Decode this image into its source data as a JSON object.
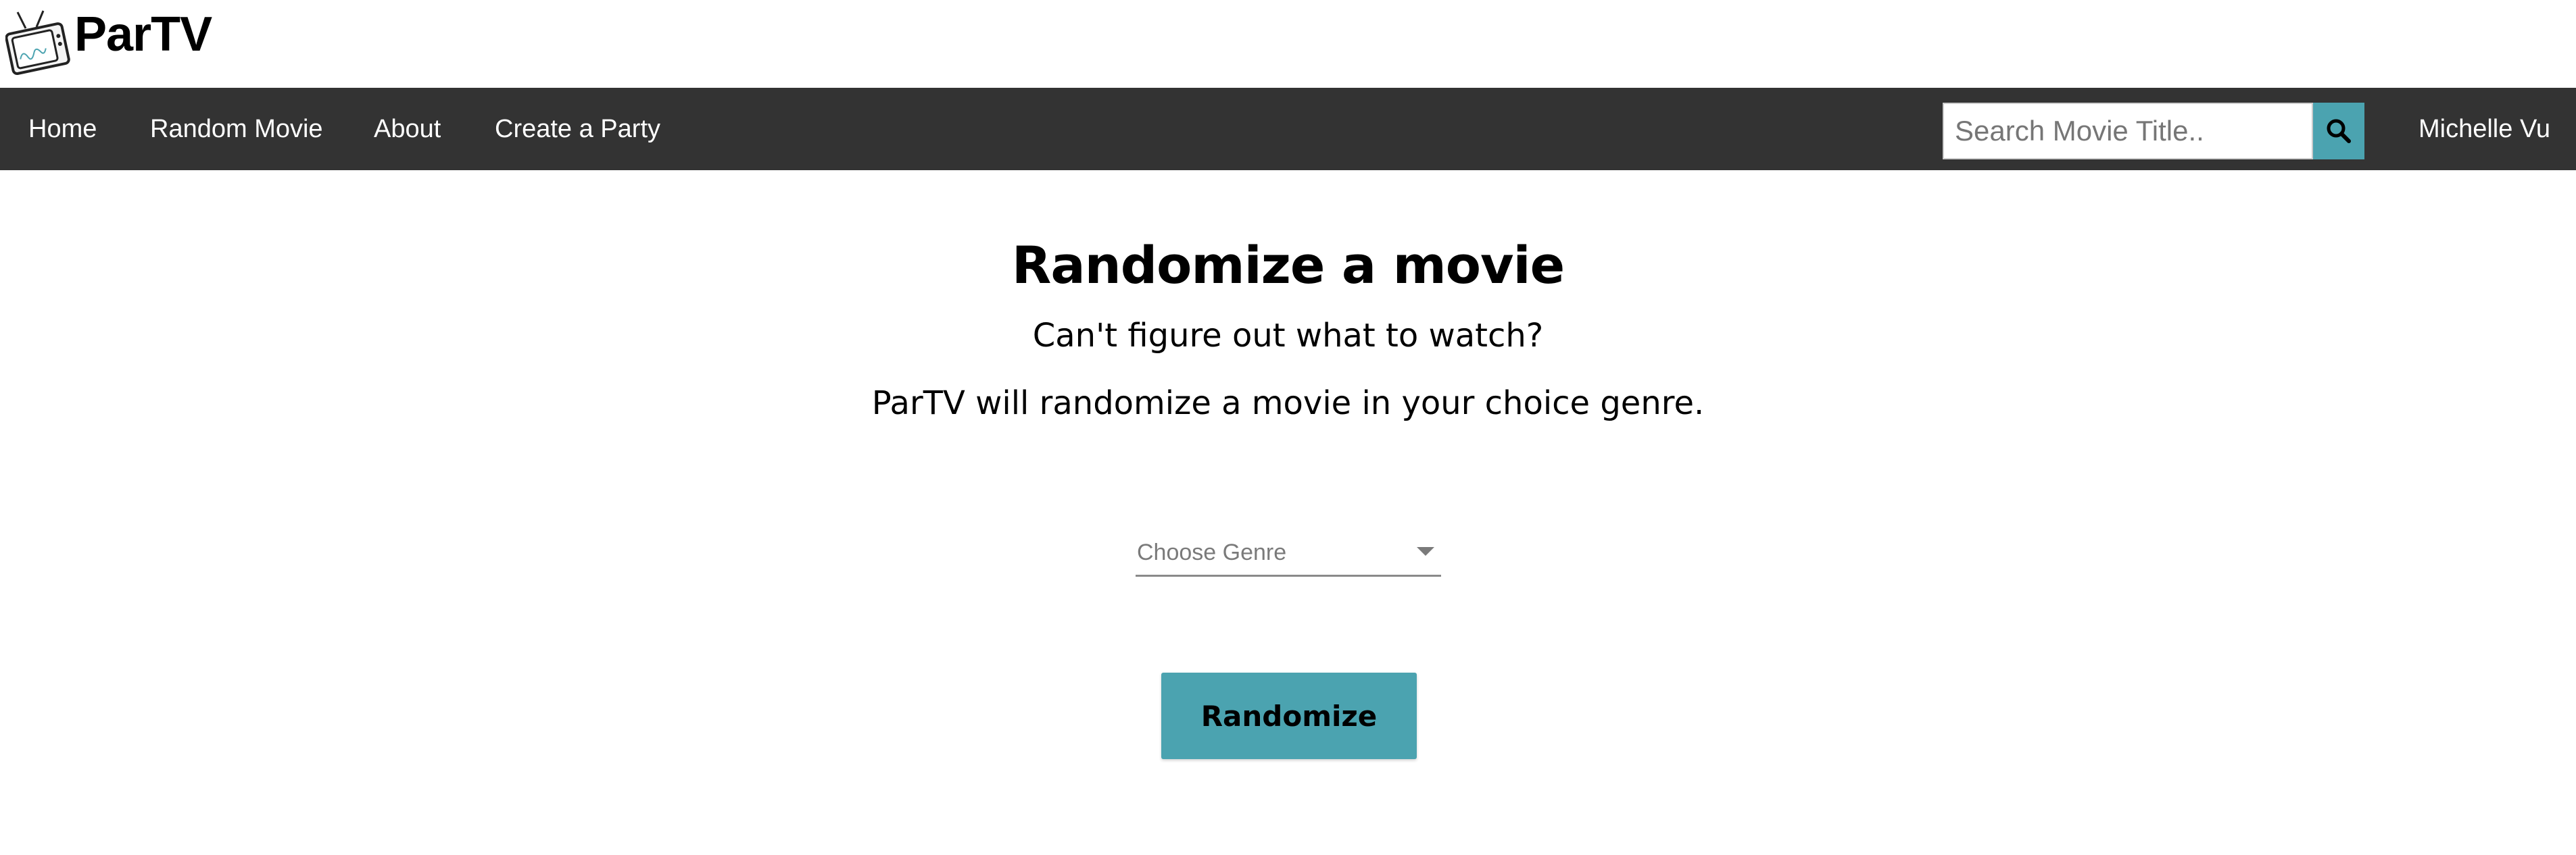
{
  "brand": {
    "name": "ParTV",
    "logo_icon": "retro-tv-icon",
    "logo_text": "ParTV"
  },
  "nav": {
    "items": [
      {
        "label": "Home"
      },
      {
        "label": "Random Movie"
      },
      {
        "label": "About"
      },
      {
        "label": "Create a Party"
      }
    ],
    "search": {
      "placeholder": "Search Movie Title..",
      "value": "",
      "button_icon": "search-icon"
    },
    "user": {
      "name": "Michelle Vu"
    }
  },
  "main": {
    "title": "Randomize a movie",
    "subtitle_1": "Can't figure out what to watch?",
    "subtitle_2": "ParTV will randomize a movie in your choice genre.",
    "genre_select": {
      "placeholder": "Choose Genre",
      "icon": "chevron-down-icon"
    },
    "randomize_label": "Randomize"
  },
  "colors": {
    "navbar_bg": "#333333",
    "accent": "#4ba3b0",
    "text": "#000000",
    "nav_text": "#ffffff"
  }
}
